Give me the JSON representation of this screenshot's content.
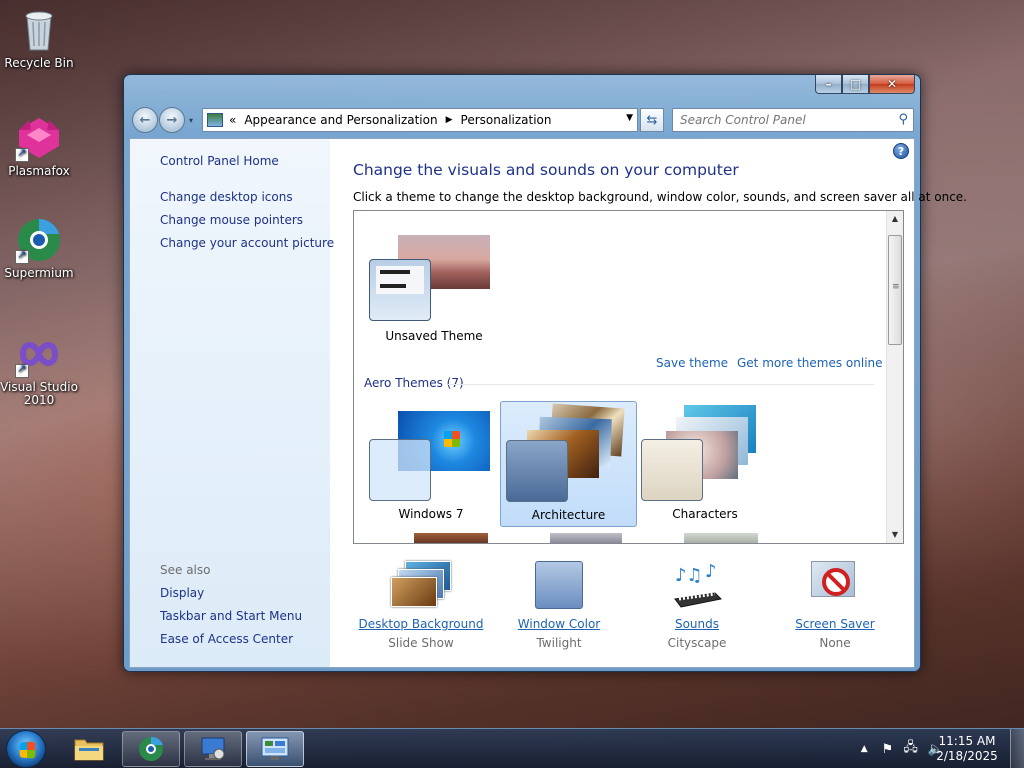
{
  "desktop": {
    "icons": [
      {
        "label": "Recycle Bin",
        "icon": "recycle-bin-icon"
      },
      {
        "label": "Plasmafox",
        "icon": "plasmafox-icon"
      },
      {
        "label": "Supermium",
        "icon": "supermium-icon"
      },
      {
        "label": "Visual Studio 2010",
        "icon": "visual-studio-icon"
      }
    ]
  },
  "window": {
    "address": {
      "overflow": "«",
      "crumbs": [
        "Appearance and Personalization",
        "Personalization"
      ]
    },
    "search": {
      "placeholder": "Search Control Panel"
    },
    "left_pane": {
      "home": "Control Panel Home",
      "links": [
        "Change desktop icons",
        "Change mouse pointers",
        "Change your account picture"
      ],
      "see_also_label": "See also",
      "see_also": [
        "Display",
        "Taskbar and Start Menu",
        "Ease of Access Center"
      ]
    },
    "title": "Change the visuals and sounds on your computer",
    "subtitle": "Click a theme to change the desktop background, window color, sounds, and screen saver all at once.",
    "themes": {
      "unsaved": "Unsaved Theme",
      "save_link": "Save theme",
      "more_link": "Get more themes online",
      "group_header": "Aero Themes (7)",
      "items": [
        {
          "name": "Windows 7",
          "selected": false
        },
        {
          "name": "Architecture",
          "selected": true
        },
        {
          "name": "Characters",
          "selected": false
        }
      ]
    },
    "bottom": [
      {
        "label": "Desktop Background",
        "value": "Slide Show",
        "icon": "desktop-background-icon"
      },
      {
        "label": "Window Color",
        "value": "Twilight",
        "icon": "window-color-icon"
      },
      {
        "label": "Sounds",
        "value": "Cityscape",
        "icon": "sounds-icon"
      },
      {
        "label": "Screen Saver",
        "value": "None",
        "icon": "screen-saver-icon"
      }
    ]
  },
  "taskbar": {
    "clock_time": "11:15 AM",
    "clock_date": "2/18/2025"
  }
}
